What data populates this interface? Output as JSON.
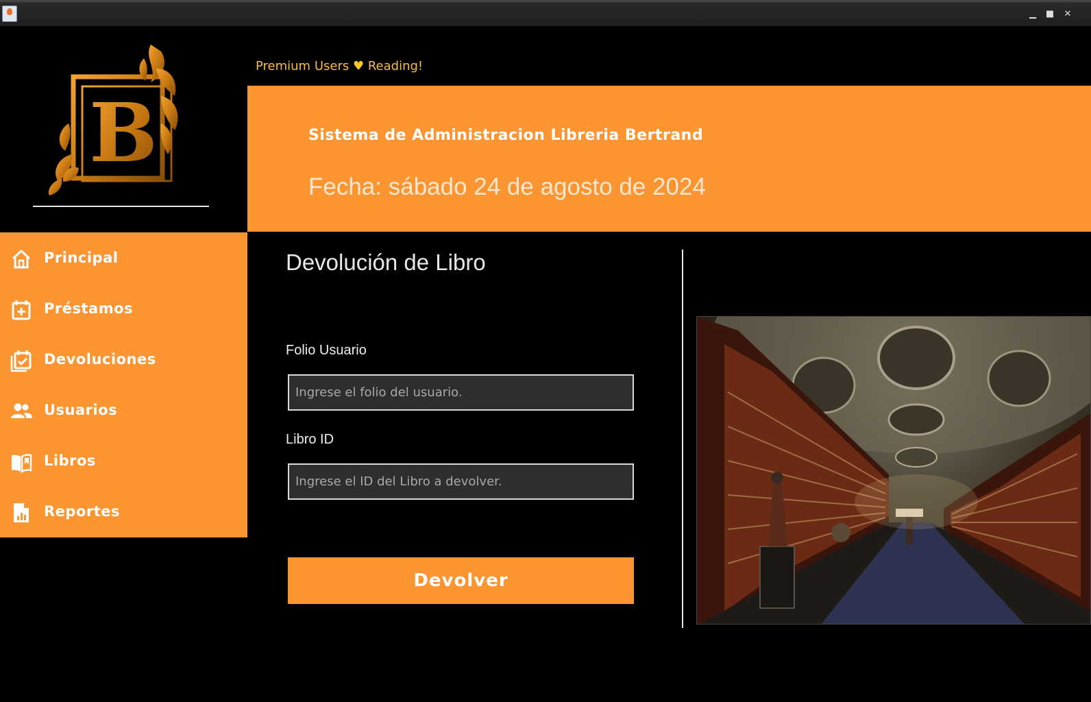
{
  "window": {
    "controls": {
      "minimize": "▁",
      "maximize": "■",
      "close": "✕"
    }
  },
  "header": {
    "tagline_left": "Premium Users",
    "tagline_heart": "♥",
    "tagline_right": "Reading!",
    "app_title": "Sistema de Administracion Libreria Bertrand",
    "date": "Fecha: sábado 24 de agosto de 2024"
  },
  "logo": {
    "letter": "B"
  },
  "sidebar": {
    "items": [
      {
        "label": "Principal",
        "icon": "home-icon"
      },
      {
        "label": "Préstamos",
        "icon": "calendar-plus-icon"
      },
      {
        "label": "Devoluciones",
        "icon": "calendar-check-icon"
      },
      {
        "label": "Usuarios",
        "icon": "users-icon"
      },
      {
        "label": "Libros",
        "icon": "book-open-icon"
      },
      {
        "label": "Reportes",
        "icon": "report-icon"
      }
    ]
  },
  "form": {
    "title": "Devolución de Libro",
    "folio_label": "Folio Usuario",
    "folio_placeholder": "Ingrese el folio del usuario.",
    "libro_label": "Libro ID",
    "libro_placeholder": "Ingrese el ID del Libro a devolver.",
    "submit_label": "Devolver"
  },
  "colors": {
    "accent": "#fb9532",
    "background": "#000000",
    "tagline": "#fbbd40",
    "logo_gold": "#d98a1c"
  }
}
